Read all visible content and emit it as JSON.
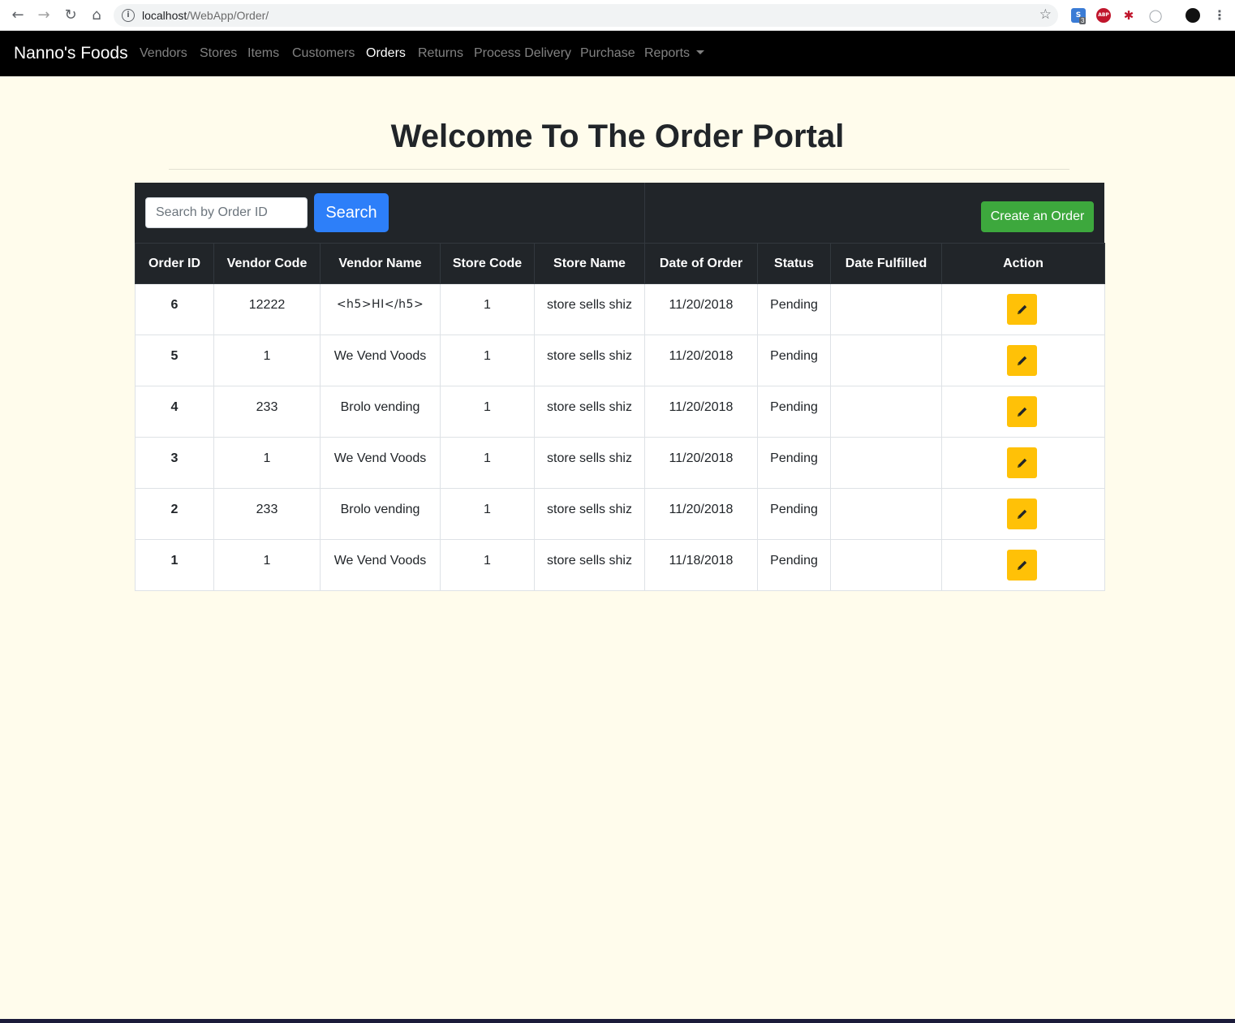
{
  "browser": {
    "url_host": "localhost",
    "url_path": "/WebApp/Order/",
    "ext_badge": "3",
    "ext_abp": "ABP"
  },
  "navbar": {
    "brand": "Nanno's Foods",
    "items": [
      {
        "label": "Vendors"
      },
      {
        "label": "Stores"
      },
      {
        "label": "Items"
      },
      {
        "label": "Customers"
      },
      {
        "label": "Orders"
      },
      {
        "label": "Returns"
      },
      {
        "label": "Process Delivery"
      },
      {
        "label": "Purchase"
      },
      {
        "label": "Reports"
      }
    ]
  },
  "page": {
    "title": "Welcome To The Order Portal"
  },
  "toolbar": {
    "search_placeholder": "Search by Order ID",
    "search_label": "Search",
    "create_label": "Create an Order"
  },
  "table": {
    "headers": [
      "Order ID",
      "Vendor Code",
      "Vendor Name",
      "Store Code",
      "Store Name",
      "Date of Order",
      "Status",
      "Date Fulfilled",
      "Action"
    ],
    "rows": [
      {
        "order_id": "6",
        "vendor_code": "12222",
        "vendor_name": "<h5>HI</h5>",
        "store_code": "1",
        "store_name": "store sells shiz",
        "date_of_order": "11/20/2018",
        "status": "Pending",
        "date_fulfilled": ""
      },
      {
        "order_id": "5",
        "vendor_code": "1",
        "vendor_name": "We Vend Voods",
        "store_code": "1",
        "store_name": "store sells shiz",
        "date_of_order": "11/20/2018",
        "status": "Pending",
        "date_fulfilled": ""
      },
      {
        "order_id": "4",
        "vendor_code": "233",
        "vendor_name": "Brolo vending",
        "store_code": "1",
        "store_name": "store sells shiz",
        "date_of_order": "11/20/2018",
        "status": "Pending",
        "date_fulfilled": ""
      },
      {
        "order_id": "3",
        "vendor_code": "1",
        "vendor_name": "We Vend Voods",
        "store_code": "1",
        "store_name": "store sells shiz",
        "date_of_order": "11/20/2018",
        "status": "Pending",
        "date_fulfilled": ""
      },
      {
        "order_id": "2",
        "vendor_code": "233",
        "vendor_name": "Brolo vending",
        "store_code": "1",
        "store_name": "store sells shiz",
        "date_of_order": "11/20/2018",
        "status": "Pending",
        "date_fulfilled": ""
      },
      {
        "order_id": "1",
        "vendor_code": "1",
        "vendor_name": "We Vend Voods",
        "store_code": "1",
        "store_name": "store sells shiz",
        "date_of_order": "11/18/2018",
        "status": "Pending",
        "date_fulfilled": ""
      }
    ]
  },
  "icons": {
    "edit": "pencil-icon"
  },
  "colors": {
    "navbar_bg": "#000000",
    "page_bg": "#fffcec",
    "table_header_bg": "#212529",
    "search_button": "#2d7ff9",
    "create_button": "#3da83d",
    "edit_button": "#ffc107"
  }
}
